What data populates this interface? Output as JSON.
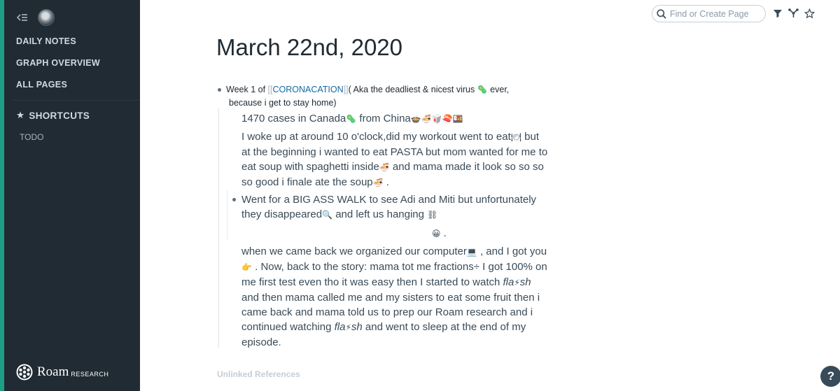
{
  "app": {
    "brand": "Roam",
    "brand_sub": "RESEARCH"
  },
  "colors": {
    "sidebar_bg": "#202b33",
    "accent_stripe": "#1f9e86",
    "link": "#106ba3"
  },
  "sidebar": {
    "nav": [
      {
        "label": "DAILY NOTES"
      },
      {
        "label": "GRAPH OVERVIEW"
      },
      {
        "label": "ALL PAGES"
      }
    ],
    "shortcuts_header": "SHORTCUTS",
    "shortcuts": [
      {
        "label": "TODO"
      }
    ]
  },
  "topbar": {
    "search_placeholder": "Find or Create Page",
    "icons": [
      "filter-icon",
      "graph-branch-icon",
      "star-icon"
    ]
  },
  "page": {
    "title": "March 22nd, 2020",
    "blocks": {
      "week_prefix": "Week 1 of ",
      "week_link_open": "[[",
      "week_link": "CORONACATION",
      "week_link_close": "]]",
      "week_rest": "( Aka the deadliest & nicest virus",
      "week_tail": " ever,",
      "week_line2": "because i get to stay home)",
      "cases_a": "1470 cases in Canada",
      "cases_b": " from China",
      "woke_a": "I woke up at around 10 o'clock,did my workout went to eat",
      "woke_b": " but at the beginning i wanted to eat PASTA  but mom wanted for me to eat soup with spaghetti inside",
      "woke_c": " and mama made it look so so so so good i finale ate the soup",
      "woke_d": " .",
      "walk_a": "Went for a BIG ASS WALK to see Adi and Miti but unfortunately they disappeared",
      "walk_b": " and left us hanging ",
      "smile_tail": " .",
      "back_a": "when we came back we organized our computer",
      "back_b": " , and I got you",
      "back_c": " . Now, back to the story: mama tot me fractions",
      "back_d": "  I got 100% on me first test even tho it was easy then I started to watch ",
      "flash_1": "fla",
      "flash_2": "sh",
      "back_e": " and then mama called me and my sisters to eat some fruit then i came back and mama told us to prep our Roam research and i continued watching ",
      "back_f": " and went to sleep at the end of my episode."
    },
    "unlinked_references": "Unlinked References"
  },
  "help_label": "?"
}
